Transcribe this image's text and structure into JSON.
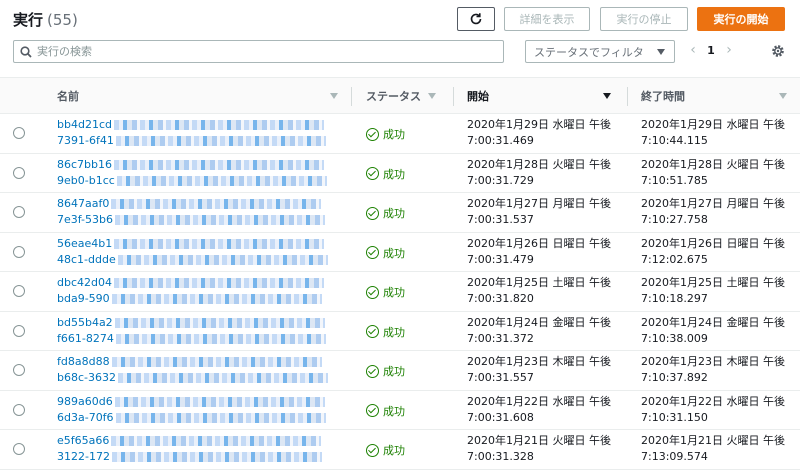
{
  "header": {
    "title": "実行",
    "count": "(55)",
    "details_label": "詳細を表示",
    "stop_label": "実行の停止",
    "start_label": "実行の開始"
  },
  "toolbar": {
    "search_placeholder": "実行の検索",
    "filter_label": "ステータスでフィルタ",
    "page": "1"
  },
  "columns": {
    "name": "名前",
    "status": "ステータス",
    "start": "開始",
    "end": "終了時間"
  },
  "rows": [
    {
      "name1": "bb4d21cd",
      "name2": "7391-6f41",
      "status": "成功",
      "start1": "2020年1月29日 水曜日 午後",
      "start2": "7:00:31.469",
      "end1": "2020年1月29日 水曜日 午後",
      "end2": "7:10:44.115"
    },
    {
      "name1": "86c7bb16",
      "name2": "9eb0-b1cc",
      "status": "成功",
      "start1": "2020年1月28日 火曜日 午後",
      "start2": "7:00:31.729",
      "end1": "2020年1月28日 火曜日 午後",
      "end2": "7:10:51.785"
    },
    {
      "name1": "8647aaf0",
      "name2": "7e3f-53b6",
      "status": "成功",
      "start1": "2020年1月27日 月曜日 午後",
      "start2": "7:00:31.537",
      "end1": "2020年1月27日 月曜日 午後",
      "end2": "7:10:27.758"
    },
    {
      "name1": "56eae4b1",
      "name2": "48c1-ddde",
      "status": "成功",
      "start1": "2020年1月26日 日曜日 午後",
      "start2": "7:00:31.479",
      "end1": "2020年1月26日 日曜日 午後",
      "end2": "7:12:02.675"
    },
    {
      "name1": "dbc42d04",
      "name2": "bda9-590",
      "status": "成功",
      "start1": "2020年1月25日 土曜日 午後",
      "start2": "7:00:31.820",
      "end1": "2020年1月25日 土曜日 午後",
      "end2": "7:10:18.297"
    },
    {
      "name1": "bd55b4a2",
      "name2": "f661-8274",
      "status": "成功",
      "start1": "2020年1月24日 金曜日 午後",
      "start2": "7:00:31.372",
      "end1": "2020年1月24日 金曜日 午後",
      "end2": "7:10:38.009"
    },
    {
      "name1": "fd8a8d88",
      "name2": "b68c-3632",
      "status": "成功",
      "start1": "2020年1月23日 木曜日 午後",
      "start2": "7:00:31.557",
      "end1": "2020年1月23日 木曜日 午後",
      "end2": "7:10:37.892"
    },
    {
      "name1": "989a60d6",
      "name2": "6d3a-70f6",
      "status": "成功",
      "start1": "2020年1月22日 水曜日 午後",
      "start2": "7:00:31.608",
      "end1": "2020年1月22日 水曜日 午後",
      "end2": "7:10:31.150"
    },
    {
      "name1": "e5f65a66",
      "name2": "3122-172",
      "status": "成功",
      "start1": "2020年1月21日 火曜日 午後",
      "start2": "7:00:31.328",
      "end1": "2020年1月21日 火曜日 午後",
      "end2": "7:13:09.574"
    }
  ]
}
